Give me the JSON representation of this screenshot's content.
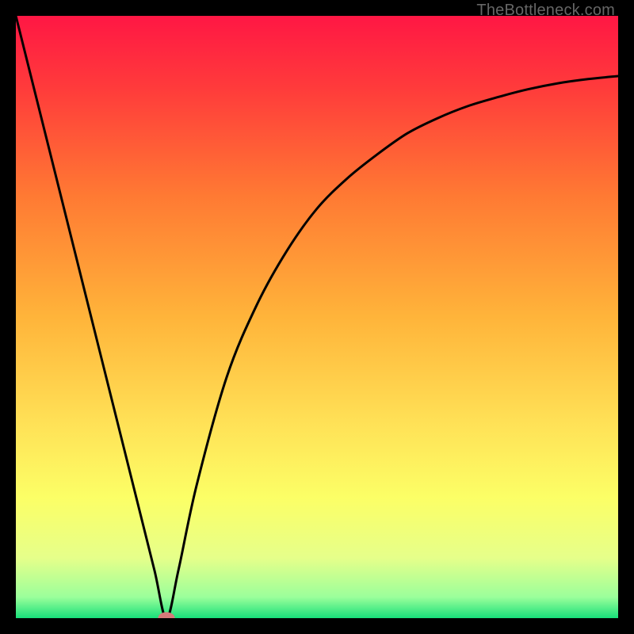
{
  "watermark": "TheBottleneck.com",
  "chart_data": {
    "type": "line",
    "title": "",
    "xlabel": "",
    "ylabel": "",
    "xlim": [
      0,
      100
    ],
    "ylim": [
      0,
      100
    ],
    "grid": false,
    "legend": false,
    "gradient_stops": [
      {
        "offset": 0.0,
        "color": "#ff1744"
      },
      {
        "offset": 0.12,
        "color": "#ff3b3b"
      },
      {
        "offset": 0.3,
        "color": "#ff7a33"
      },
      {
        "offset": 0.5,
        "color": "#ffb43a"
      },
      {
        "offset": 0.68,
        "color": "#ffe257"
      },
      {
        "offset": 0.8,
        "color": "#fcff66"
      },
      {
        "offset": 0.9,
        "color": "#e6ff8a"
      },
      {
        "offset": 0.965,
        "color": "#9bff9b"
      },
      {
        "offset": 1.0,
        "color": "#18e07a"
      }
    ],
    "marker": {
      "x": 25.0,
      "y": 0.0,
      "color": "#d77a7a",
      "rx": 1.4,
      "ry": 1.0
    },
    "series": [
      {
        "name": "curve",
        "x": [
          0,
          5,
          10,
          15,
          20,
          23,
          25,
          27,
          30,
          35,
          40,
          45,
          50,
          55,
          60,
          65,
          70,
          75,
          80,
          85,
          90,
          95,
          100
        ],
        "y": [
          100,
          80,
          60,
          40,
          20,
          8,
          0,
          8,
          22,
          40,
          52,
          61,
          68,
          73,
          77,
          80.5,
          83,
          85,
          86.5,
          87.8,
          88.8,
          89.5,
          90
        ]
      }
    ]
  }
}
